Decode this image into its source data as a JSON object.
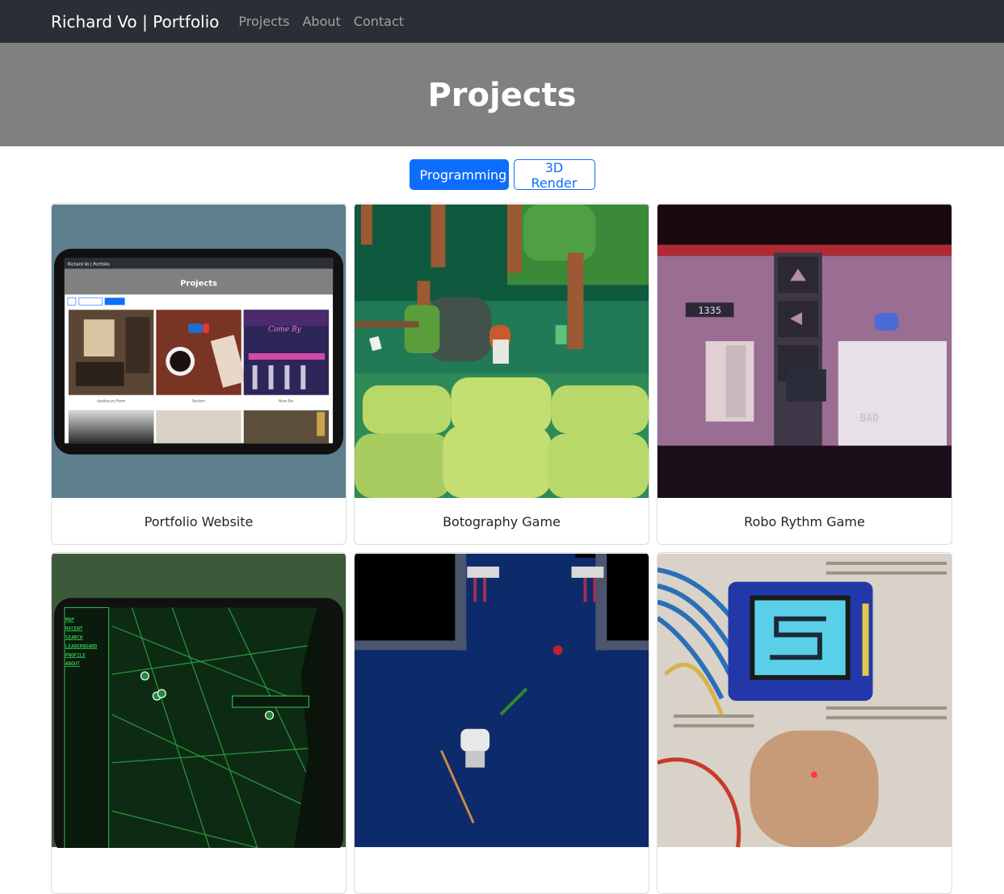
{
  "nav": {
    "brand": "Richard Vo | Portfolio",
    "links": [
      "Projects",
      "About",
      "Contact"
    ]
  },
  "hero": {
    "title": "Projects"
  },
  "filters": [
    {
      "label": "Programming",
      "active": true
    },
    {
      "label": "3D Render",
      "active": false
    }
  ],
  "projects": [
    {
      "title": "Portfolio Website",
      "thumb_icon": "tablet-portfolio-screenshot"
    },
    {
      "title": "Botography Game",
      "thumb_icon": "pixel-forest-game"
    },
    {
      "title": "Robo Rythm Game",
      "thumb_icon": "pixel-robot-rhythm-game"
    },
    {
      "title": "",
      "thumb_icon": "tablet-green-map"
    },
    {
      "title": "",
      "thumb_icon": "pixel-dungeon-game"
    },
    {
      "title": "",
      "thumb_icon": "breadboard-lcd-display"
    }
  ],
  "mockup": {
    "brand": "Richard Vo | Portfolio",
    "title": "Projects",
    "filters": [
      "All",
      "Programming",
      "3D Render"
    ],
    "captions": [
      "Apothecary Room",
      "Realism",
      "Neon Bar"
    ],
    "map_menu": [
      "MAP",
      "RECENT",
      "SEARCH",
      "LEADERBOARD",
      "PROFILE",
      "ABOUT"
    ]
  },
  "game_text": {
    "score": "1335",
    "judgement": "BAD"
  }
}
